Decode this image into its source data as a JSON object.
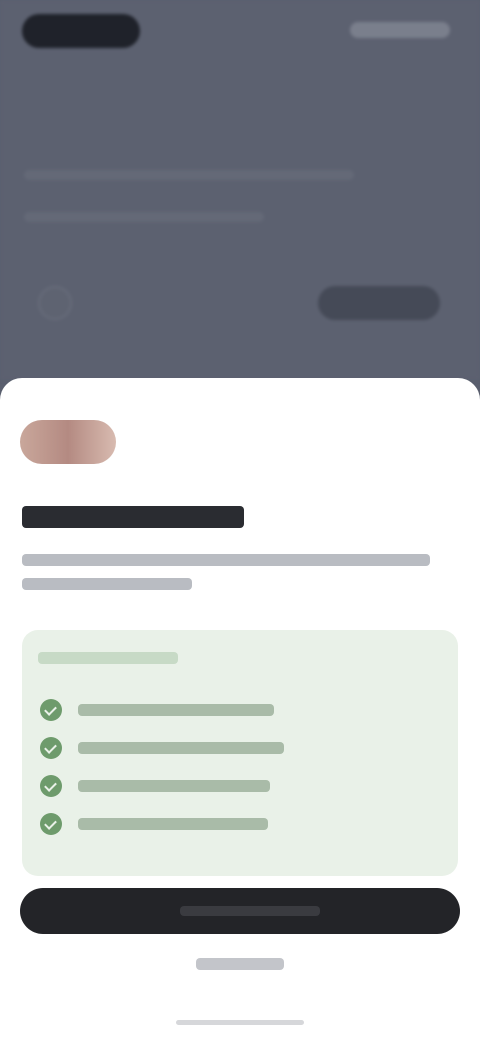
{
  "background_app": {
    "dimmed": true
  },
  "sheet": {
    "title": "",
    "description": "",
    "benefits_heading": "",
    "benefits": [
      "",
      "",
      "",
      ""
    ],
    "primary_button_label": "",
    "secondary_link_label": ""
  },
  "colors": {
    "overlay": "#5c6170",
    "sheet": "#ffffff",
    "card": "#e9f1e8",
    "check": "#6e9b6c",
    "primary_button": "#232428"
  },
  "icons": {
    "logo": "brand-logo",
    "benefit": "check-icon"
  }
}
